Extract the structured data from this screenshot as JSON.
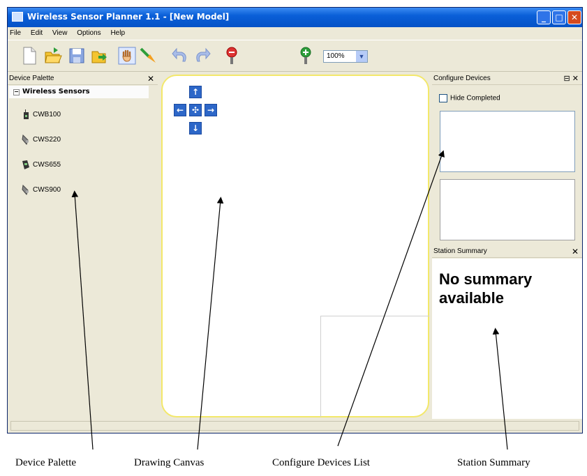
{
  "window": {
    "title": "Wireless Sensor Planner 1.1 - [New Model]"
  },
  "menu": [
    "File",
    "Edit",
    "View",
    "Options",
    "Help"
  ],
  "toolbar": {
    "icons": [
      "new-icon",
      "open-icon",
      "save-icon",
      "export-icon",
      "pan-hand-icon",
      "place-device-icon",
      "undo-icon",
      "redo-icon",
      "zoom-out-icon",
      "zoom-in-icon"
    ],
    "zoom_value": "100%"
  },
  "palette": {
    "title": "Device Palette",
    "group": "Wireless Sensors",
    "devices": [
      "CWB100",
      "CWS220",
      "CWS655",
      "CWS900"
    ]
  },
  "config": {
    "title": "Configure Devices",
    "hide_completed_label": "Hide Completed"
  },
  "summary": {
    "title": "Station Summary",
    "message": "No summary available"
  },
  "callouts": [
    "Device Palette",
    "Drawing Canvas",
    "Configure Devices List",
    "Station Summary"
  ]
}
